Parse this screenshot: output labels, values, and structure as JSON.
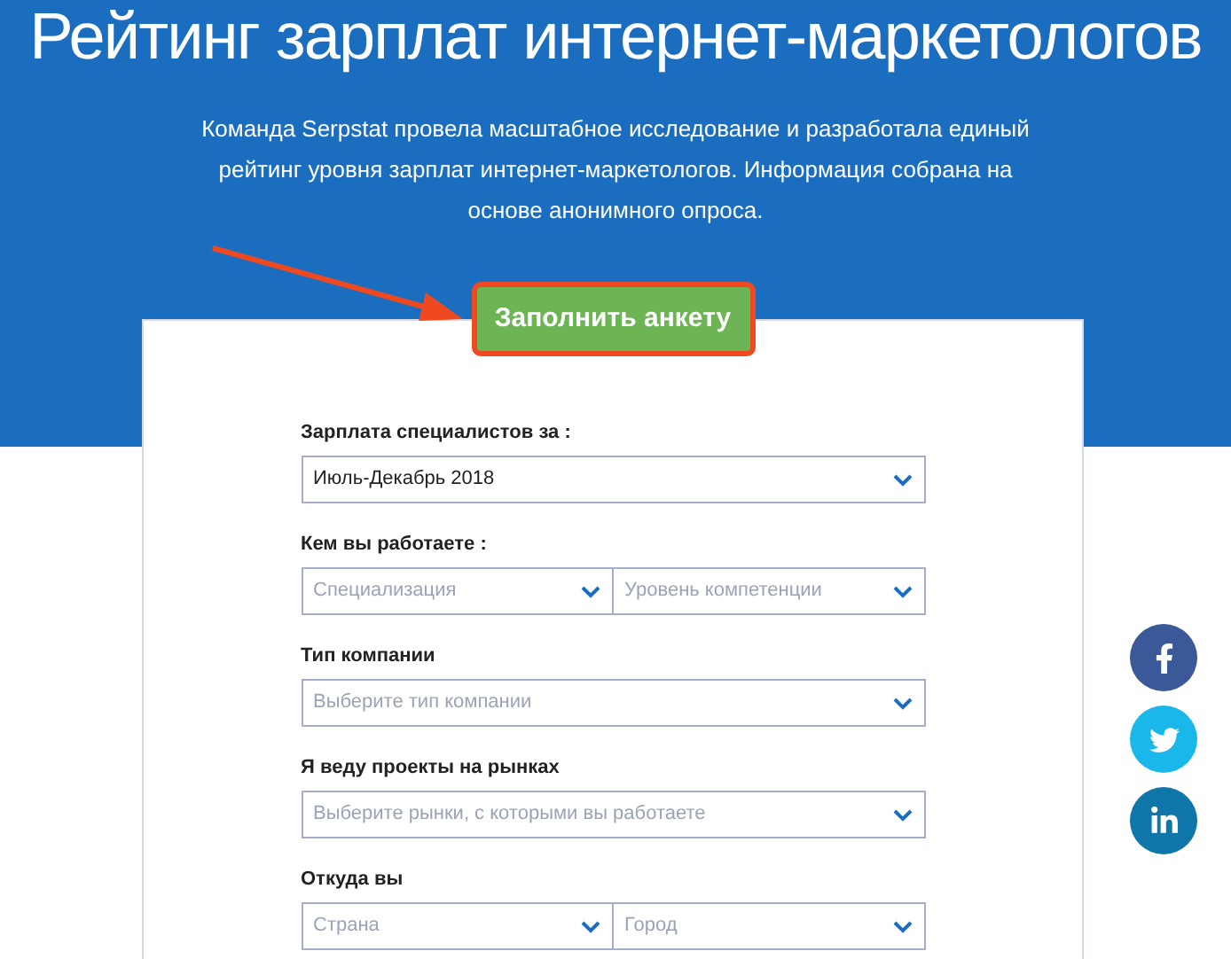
{
  "title": "Рейтинг зарплат интернет-маркетологов",
  "intro": "Команда Serpstat провела масштабное исследование и разработала единый рейтинг уровня зарплат интернет-маркетологов. Информация собрана на основе анонимного опроса.",
  "cta_button": "Заполнить анкету",
  "form": [
    {
      "label": "Зарплата специалистов за :",
      "selects": [
        {
          "value": "Июль-Декабрь 2018"
        }
      ]
    },
    {
      "label": "Кем вы работаете :",
      "selects": [
        {
          "placeholder": "Специализация"
        },
        {
          "placeholder": "Уровень компетенции"
        }
      ]
    },
    {
      "label": "Тип компании",
      "selects": [
        {
          "placeholder": "Выберите тип компании"
        }
      ]
    },
    {
      "label": "Я веду проекты на рынках",
      "selects": [
        {
          "placeholder": "Выберите рынки, с которыми вы работаете"
        }
      ]
    },
    {
      "label": "Откуда вы",
      "selects": [
        {
          "placeholder": "Страна"
        },
        {
          "placeholder": "Город"
        }
      ]
    }
  ],
  "social": [
    {
      "kind": "facebook",
      "color": "#3b5998"
    },
    {
      "kind": "twitter",
      "color": "#1ab7ea"
    },
    {
      "kind": "linkedin",
      "color": "#0e76a8"
    }
  ]
}
